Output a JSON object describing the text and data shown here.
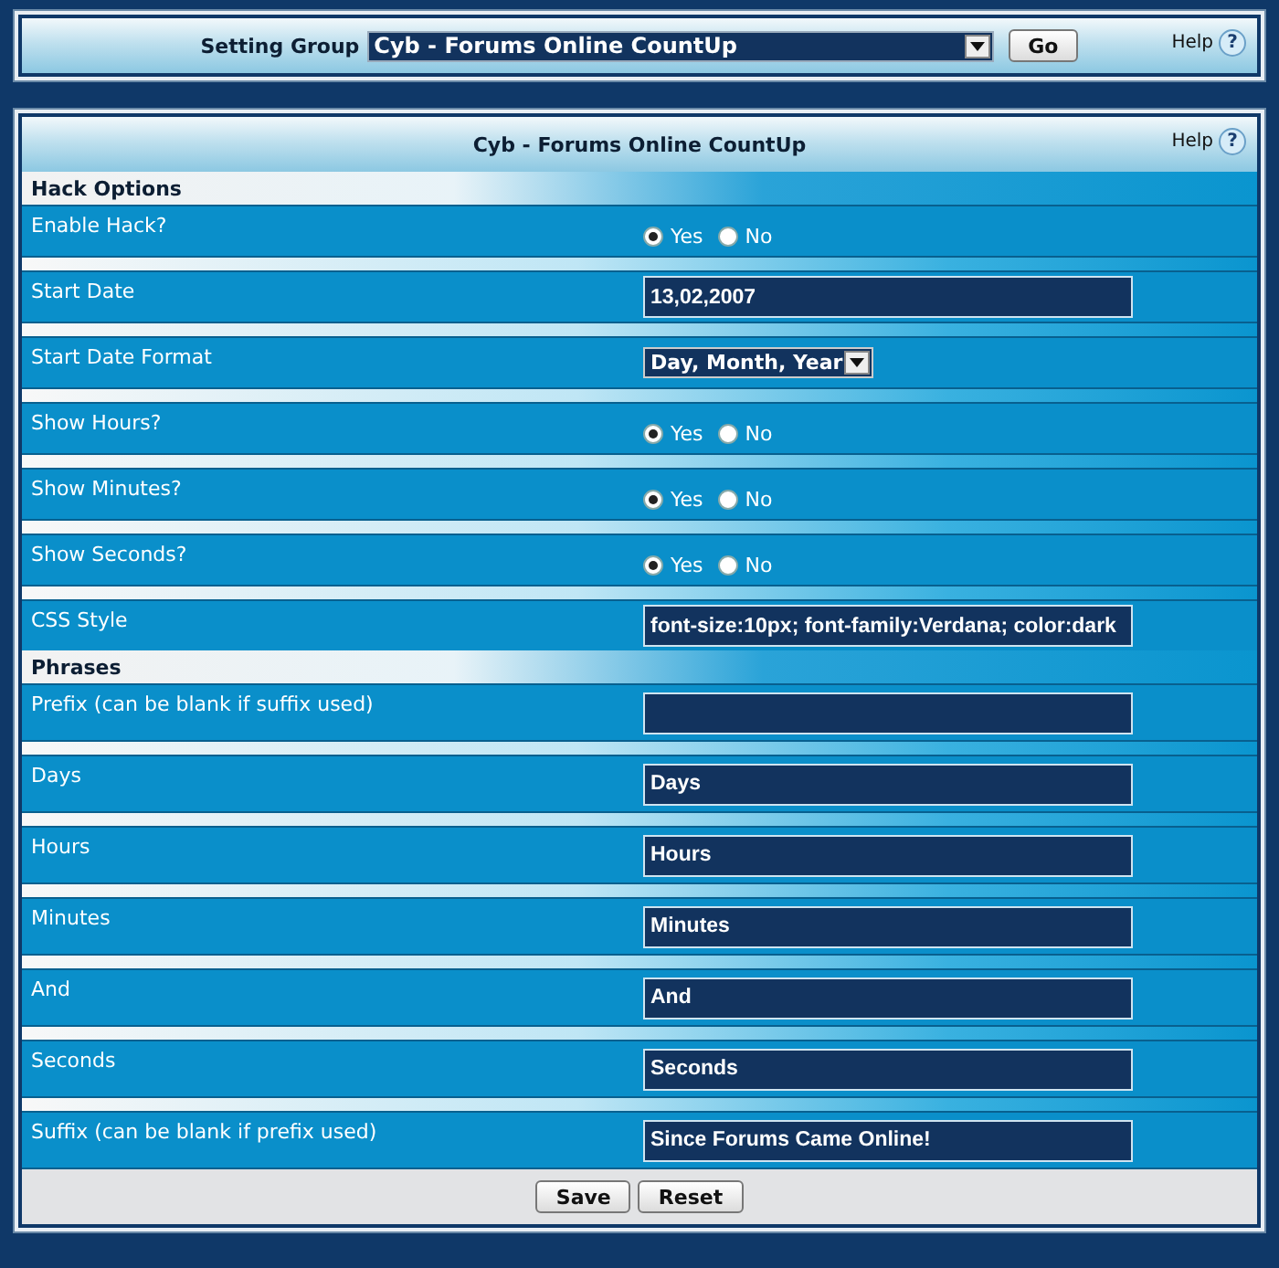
{
  "top_bar": {
    "label": "Setting Group",
    "select_value": "Cyb - Forums Online CountUp",
    "go_button": "Go",
    "help": "Help",
    "help_mark": "?"
  },
  "panel": {
    "title": "Cyb - Forums Online CountUp",
    "help": "Help",
    "help_mark": "?",
    "sections": [
      {
        "title": "Hack Options",
        "rows": [
          {
            "kind": "radio",
            "label": "Enable Hack?",
            "options": [
              {
                "label": "Yes",
                "selected": true
              },
              {
                "label": "No",
                "selected": false
              }
            ]
          },
          {
            "kind": "text",
            "label": "Start Date",
            "value": "13,02,2007"
          },
          {
            "kind": "select",
            "label": "Start Date Format",
            "value": "Day, Month, Year"
          },
          {
            "kind": "radio",
            "label": "Show Hours?",
            "options": [
              {
                "label": "Yes",
                "selected": true
              },
              {
                "label": "No",
                "selected": false
              }
            ]
          },
          {
            "kind": "radio",
            "label": "Show Minutes?",
            "options": [
              {
                "label": "Yes",
                "selected": true
              },
              {
                "label": "No",
                "selected": false
              }
            ]
          },
          {
            "kind": "radio",
            "label": "Show Seconds?",
            "options": [
              {
                "label": "Yes",
                "selected": true
              },
              {
                "label": "No",
                "selected": false
              }
            ]
          },
          {
            "kind": "text",
            "label": "CSS Style",
            "value": "font-size:10px; font-family:Verdana; color:dark"
          }
        ]
      },
      {
        "title": "Phrases",
        "rows": [
          {
            "kind": "text",
            "label": "Prefix (can be blank if suffix used)"
          },
          {
            "kind": "text",
            "label": "Days",
            "value": "Days"
          },
          {
            "kind": "text",
            "label": "Hours",
            "value": "Hours"
          },
          {
            "kind": "text",
            "label": "Minutes",
            "value": "Minutes"
          },
          {
            "kind": "text",
            "label": "And",
            "value": "And"
          },
          {
            "kind": "text",
            "label": "Seconds",
            "value": "Seconds"
          },
          {
            "kind": "text",
            "label": "Suffix (can be blank if prefix used)",
            "value": "Since Forums Came Online!"
          }
        ]
      }
    ],
    "buttons": [
      "Save",
      "Reset"
    ]
  }
}
